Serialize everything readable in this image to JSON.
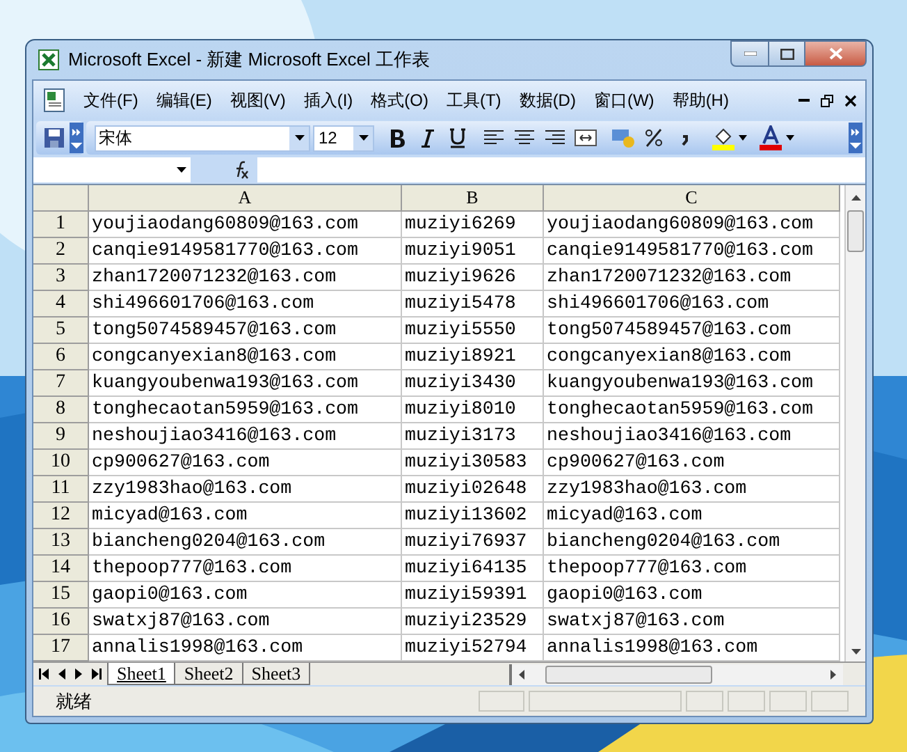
{
  "window": {
    "title": "Microsoft Excel - 新建 Microsoft Excel 工作表"
  },
  "menu": {
    "items": [
      "文件(F)",
      "编辑(E)",
      "视图(V)",
      "插入(I)",
      "格式(O)",
      "工具(T)",
      "数据(D)",
      "窗口(W)",
      "帮助(H)"
    ]
  },
  "toolbar": {
    "font": "宋体",
    "font_size": "12"
  },
  "table": {
    "columns": [
      "A",
      "B",
      "C"
    ],
    "rows": [
      {
        "number": "1",
        "cells": [
          "youjiaodang60809@163.com",
          "muziyi6269",
          "youjiaodang60809@163.com"
        ]
      },
      {
        "number": "2",
        "cells": [
          "canqie9149581770@163.com",
          "muziyi9051",
          "canqie9149581770@163.com"
        ]
      },
      {
        "number": "3",
        "cells": [
          "zhan1720071232@163.com",
          "muziyi9626",
          "zhan1720071232@163.com"
        ]
      },
      {
        "number": "4",
        "cells": [
          "shi496601706@163.com",
          "muziyi5478",
          "shi496601706@163.com"
        ]
      },
      {
        "number": "5",
        "cells": [
          "tong5074589457@163.com",
          "muziyi5550",
          "tong5074589457@163.com"
        ]
      },
      {
        "number": "6",
        "cells": [
          "congcanyexian8@163.com",
          "muziyi8921",
          "congcanyexian8@163.com"
        ]
      },
      {
        "number": "7",
        "cells": [
          "kuangyoubenwa193@163.com",
          "muziyi3430",
          "kuangyoubenwa193@163.com"
        ]
      },
      {
        "number": "8",
        "cells": [
          "tonghecaotan5959@163.com",
          "muziyi8010",
          "tonghecaotan5959@163.com"
        ]
      },
      {
        "number": "9",
        "cells": [
          "neshoujiao3416@163.com",
          "muziyi3173",
          "neshoujiao3416@163.com"
        ]
      },
      {
        "number": "10",
        "cells": [
          "cp900627@163.com",
          "muziyi30583",
          "cp900627@163.com"
        ]
      },
      {
        "number": "11",
        "cells": [
          "zzy1983hao@163.com",
          "muziyi02648",
          "zzy1983hao@163.com"
        ]
      },
      {
        "number": "12",
        "cells": [
          "micyad@163.com",
          "muziyi13602",
          "micyad@163.com"
        ]
      },
      {
        "number": "13",
        "cells": [
          "biancheng0204@163.com",
          "muziyi76937",
          "biancheng0204@163.com"
        ]
      },
      {
        "number": "14",
        "cells": [
          "thepoop777@163.com",
          "muziyi64135",
          "thepoop777@163.com"
        ]
      },
      {
        "number": "15",
        "cells": [
          "gaopi0@163.com",
          "muziyi59391",
          "gaopi0@163.com"
        ]
      },
      {
        "number": "16",
        "cells": [
          "swatxj87@163.com",
          "muziyi23529",
          "swatxj87@163.com"
        ]
      },
      {
        "number": "17",
        "cells": [
          "annalis1998@163.com",
          "muziyi52794",
          "annalis1998@163.com"
        ]
      }
    ]
  },
  "sheet_tabs": [
    {
      "label": "Sheet1",
      "selected": true
    },
    {
      "label": "Sheet2",
      "selected": false
    },
    {
      "label": "Sheet3",
      "selected": false
    }
  ],
  "status_bar": {
    "text": "就绪"
  }
}
